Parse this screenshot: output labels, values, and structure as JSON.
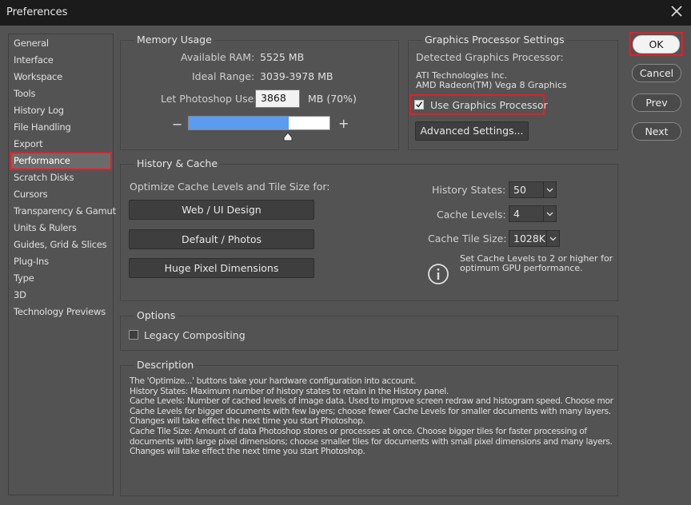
{
  "window": {
    "title": "Preferences"
  },
  "sidebar": {
    "items": [
      {
        "label": "General"
      },
      {
        "label": "Interface"
      },
      {
        "label": "Workspace"
      },
      {
        "label": "Tools"
      },
      {
        "label": "History Log"
      },
      {
        "label": "File Handling"
      },
      {
        "label": "Export"
      },
      {
        "label": "Performance"
      },
      {
        "label": "Scratch Disks"
      },
      {
        "label": "Cursors"
      },
      {
        "label": "Transparency & Gamut"
      },
      {
        "label": "Units & Rulers"
      },
      {
        "label": "Guides, Grid & Slices"
      },
      {
        "label": "Plug-Ins"
      },
      {
        "label": "Type"
      },
      {
        "label": "3D"
      },
      {
        "label": "Technology Previews"
      }
    ],
    "selected": "Performance"
  },
  "memory": {
    "title": "Memory Usage",
    "available_label": "Available RAM:",
    "available_value": "5525 MB",
    "ideal_label": "Ideal Range:",
    "ideal_value": "3039-3978 MB",
    "use_label": "Let Photoshop Use:",
    "use_value": "3868",
    "use_suffix": "MB (70%)",
    "minus": "−",
    "plus": "+",
    "slider_fraction": 0.7
  },
  "gpu": {
    "title": "Graphics Processor Settings",
    "detected_label": "Detected Graphics Processor:",
    "vendor": "ATI Technologies Inc.",
    "model": "AMD Radeon(TM) Vega 8 Graphics",
    "use_gpu_label": "Use Graphics Processor",
    "use_gpu_checked": true,
    "advanced_button": "Advanced Settings..."
  },
  "history_cache": {
    "title": "History & Cache",
    "optimize_label": "Optimize Cache Levels and Tile Size for:",
    "buttons": [
      "Web / UI Design",
      "Default / Photos",
      "Huge Pixel Dimensions"
    ],
    "history_states_label": "History States:",
    "history_states_value": "50",
    "cache_levels_label": "Cache Levels:",
    "cache_levels_value": "4",
    "tile_size_label": "Cache Tile Size:",
    "tile_size_value": "1028K",
    "info_line1": "Set Cache Levels to 2 or higher for",
    "info_line2": "optimum GPU performance."
  },
  "options": {
    "title": "Options",
    "legacy_label": "Legacy Compositing",
    "legacy_checked": false
  },
  "description": {
    "title": "Description",
    "lines": [
      "The 'Optimize...' buttons take your hardware configuration into account.",
      "History States: Maximum number of history states to retain in the History panel.",
      "Cache Levels: Number of cached levels of image data.  Used to improve screen redraw and histogram speed.  Choose more",
      "Cache Levels for bigger documents with few layers; choose fewer Cache Levels for smaller documents with many layers.",
      "Changes will take effect the next time you start Photoshop.",
      "Cache Tile Size: Amount of data Photoshop stores or processes at once. Choose bigger tiles for faster processing of",
      "documents with large pixel dimensions; choose smaller tiles for documents with small pixel dimensions and many layers.",
      "Changes will take effect the next time you start Photoshop."
    ]
  },
  "actions": {
    "ok": "OK",
    "cancel": "Cancel",
    "prev": "Prev",
    "next": "Next"
  },
  "colors": {
    "highlight": "#e0202a",
    "slider_fill": "#5b9cf0",
    "bg": "#535353"
  }
}
